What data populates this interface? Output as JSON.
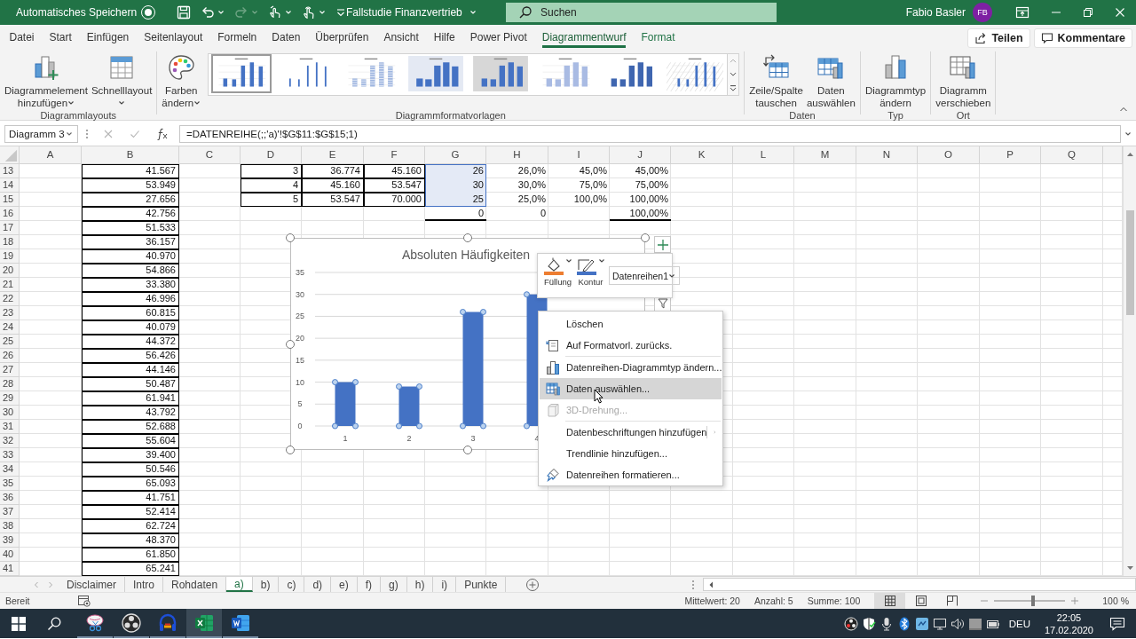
{
  "title_bar": {
    "autosave_label": "Automatisches Speichern",
    "autosave_on": false,
    "quick_access": [
      {
        "kind": "save",
        "disabled": false,
        "dropdown": false
      },
      {
        "kind": "undo",
        "disabled": false,
        "dropdown": true
      },
      {
        "kind": "redo",
        "disabled": true,
        "dropdown": true
      },
      {
        "kind": "touch",
        "disabled": false,
        "dropdown": true
      },
      {
        "kind": "pointer",
        "disabled": false,
        "dropdown": true
      },
      {
        "kind": "customize",
        "disabled": false,
        "dropdown": false
      }
    ],
    "document_title": "Fallstudie Finanzvertrieb",
    "search": {
      "placeholder": "Suchen"
    },
    "user_name": "Fabio Basler",
    "user_initials": "FB"
  },
  "ribbon_tabs": [
    {
      "label": "Datei",
      "kind": "normal",
      "selected": false
    },
    {
      "label": "Start",
      "kind": "normal",
      "selected": false
    },
    {
      "label": "Einfügen",
      "kind": "normal",
      "selected": false
    },
    {
      "label": "Seitenlayout",
      "kind": "normal",
      "selected": false
    },
    {
      "label": "Formeln",
      "kind": "normal",
      "selected": false
    },
    {
      "label": "Daten",
      "kind": "normal",
      "selected": false
    },
    {
      "label": "Überprüfen",
      "kind": "normal",
      "selected": false
    },
    {
      "label": "Ansicht",
      "kind": "normal",
      "selected": false
    },
    {
      "label": "Hilfe",
      "kind": "normal",
      "selected": false
    },
    {
      "label": "Power Pivot",
      "kind": "normal",
      "selected": false
    },
    {
      "label": "Diagrammentwurf",
      "kind": "contextual",
      "selected": true
    },
    {
      "label": "Format",
      "kind": "contextual",
      "selected": false
    }
  ],
  "share_button": "Teilen",
  "comments_button": "Kommentare",
  "ribbon_groups": [
    {
      "label": "Diagrammlayouts",
      "items": [
        {
          "kind": "add-element",
          "label": "Diagrammelement hinzufügen",
          "dropdown": true
        },
        {
          "kind": "quick-layout",
          "label": "Schnelllayout",
          "dropdown": true
        }
      ]
    },
    {
      "label": "Diagrammformatvorlagen",
      "items": [
        {
          "kind": "colors",
          "label": "Farben ändern",
          "dropdown": true
        },
        {
          "kind": "gallery",
          "styles": [
            {
              "selected": true
            },
            {
              "selected": false
            },
            {
              "selected": false
            },
            {
              "selected": false
            },
            {
              "selected": false
            },
            {
              "selected": false
            },
            {
              "selected": false
            },
            {
              "selected": false
            }
          ]
        }
      ]
    },
    {
      "label": "Daten",
      "items": [
        {
          "kind": "swap",
          "label": "Zeile/Spalte tauschen",
          "dropdown": false
        },
        {
          "kind": "select-data",
          "label": "Daten auswählen",
          "dropdown": false
        }
      ]
    },
    {
      "label": "Typ",
      "items": [
        {
          "kind": "change-type",
          "label": "Diagrammtyp ändern",
          "dropdown": false
        }
      ]
    },
    {
      "label": "Ort",
      "items": [
        {
          "kind": "move",
          "label": "Diagramm verschieben",
          "dropdown": false
        }
      ]
    }
  ],
  "formula_bar": {
    "name_box": "Diagramm 3",
    "formula": "=DATENREIHE(;;'a)'!$G$11:$G$15;1)"
  },
  "sheet": {
    "columns": [
      "A",
      "B",
      "C",
      "D",
      "E",
      "F",
      "G",
      "H",
      "I",
      "J",
      "K",
      "L",
      "M",
      "N",
      "O",
      "P",
      "Q"
    ],
    "rows": [
      {
        "header": "13",
        "cells": [
          {},
          {
            "value": "41.567",
            "highlighted": false
          },
          {},
          {
            "value": "3",
            "highlighted": false
          },
          {
            "value": "36.774",
            "highlighted": false
          },
          {
            "value": "45.160",
            "highlighted": false
          },
          {
            "value": "26",
            "highlighted": true
          },
          {
            "value": "26,0%",
            "highlighted": false
          },
          {
            "value": "45,0%",
            "highlighted": false
          },
          {
            "value": "45,00%",
            "highlighted": false
          }
        ]
      },
      {
        "header": "14",
        "cells": [
          {},
          {
            "value": "53.949",
            "highlighted": false
          },
          {},
          {
            "value": "4",
            "highlighted": false
          },
          {
            "value": "45.160",
            "highlighted": false
          },
          {
            "value": "53.547",
            "highlighted": false
          },
          {
            "value": "30",
            "highlighted": true
          },
          {
            "value": "30,0%",
            "highlighted": false
          },
          {
            "value": "75,0%",
            "highlighted": false
          },
          {
            "value": "75,00%",
            "highlighted": false
          }
        ]
      },
      {
        "header": "15",
        "cells": [
          {},
          {
            "value": "27.656",
            "highlighted": false
          },
          {},
          {
            "value": "5",
            "highlighted": false
          },
          {
            "value": "53.547",
            "highlighted": false
          },
          {
            "value": "70.000",
            "highlighted": false
          },
          {
            "value": "25",
            "highlighted": true
          },
          {
            "value": "25,0%",
            "highlighted": false
          },
          {
            "value": "100,0%",
            "highlighted": false
          },
          {
            "value": "100,00%",
            "highlighted": false
          }
        ]
      },
      {
        "header": "16",
        "cells": [
          {},
          {
            "value": "42.756",
            "highlighted": false
          },
          {},
          {},
          {},
          {},
          {
            "value": "0",
            "highlighted": false
          },
          {
            "value": "0",
            "highlighted": false
          },
          {},
          {
            "value": "100,00%",
            "highlighted": false
          }
        ]
      },
      {
        "header": "17",
        "cells": [
          {},
          {
            "value": "51.533",
            "highlighted": false
          }
        ]
      },
      {
        "header": "18",
        "cells": [
          {},
          {
            "value": "36.157",
            "highlighted": false
          }
        ]
      },
      {
        "header": "19",
        "cells": [
          {},
          {
            "value": "40.970",
            "highlighted": false
          }
        ]
      },
      {
        "header": "20",
        "cells": [
          {},
          {
            "value": "54.866",
            "highlighted": false
          }
        ]
      },
      {
        "header": "21",
        "cells": [
          {},
          {
            "value": "33.380",
            "highlighted": false
          }
        ]
      },
      {
        "header": "22",
        "cells": [
          {},
          {
            "value": "46.996",
            "highlighted": false
          }
        ]
      },
      {
        "header": "23",
        "cells": [
          {},
          {
            "value": "60.815",
            "highlighted": false
          }
        ]
      },
      {
        "header": "24",
        "cells": [
          {},
          {
            "value": "40.079",
            "highlighted": false
          }
        ]
      },
      {
        "header": "25",
        "cells": [
          {},
          {
            "value": "44.372",
            "highlighted": false
          }
        ]
      },
      {
        "header": "26",
        "cells": [
          {},
          {
            "value": "56.426",
            "highlighted": false
          }
        ]
      },
      {
        "header": "27",
        "cells": [
          {},
          {
            "value": "44.146",
            "highlighted": false
          }
        ]
      },
      {
        "header": "28",
        "cells": [
          {},
          {
            "value": "50.487",
            "highlighted": false
          }
        ]
      },
      {
        "header": "29",
        "cells": [
          {},
          {
            "value": "61.941",
            "highlighted": false
          }
        ]
      },
      {
        "header": "30",
        "cells": [
          {},
          {
            "value": "43.792",
            "highlighted": false
          }
        ]
      },
      {
        "header": "31",
        "cells": [
          {},
          {
            "value": "52.688",
            "highlighted": false
          }
        ]
      },
      {
        "header": "32",
        "cells": [
          {},
          {
            "value": "55.604",
            "highlighted": false
          }
        ]
      },
      {
        "header": "33",
        "cells": [
          {},
          {
            "value": "39.400",
            "highlighted": false
          }
        ]
      },
      {
        "header": "34",
        "cells": [
          {},
          {
            "value": "50.546",
            "highlighted": false
          }
        ]
      },
      {
        "header": "35",
        "cells": [
          {},
          {
            "value": "65.093",
            "highlighted": false
          }
        ]
      },
      {
        "header": "36",
        "cells": [
          {},
          {
            "value": "41.751",
            "highlighted": false
          }
        ]
      },
      {
        "header": "37",
        "cells": [
          {},
          {
            "value": "52.414",
            "highlighted": false
          }
        ]
      },
      {
        "header": "38",
        "cells": [
          {},
          {
            "value": "62.724",
            "highlighted": false
          }
        ]
      },
      {
        "header": "39",
        "cells": [
          {},
          {
            "value": "48.370",
            "highlighted": false
          }
        ]
      },
      {
        "header": "40",
        "cells": [
          {},
          {
            "value": "61.850",
            "highlighted": false
          }
        ]
      },
      {
        "header": "41",
        "cells": [
          {},
          {
            "value": "65.241",
            "highlighted": false
          }
        ]
      }
    ]
  },
  "chart": {
    "selected": true,
    "chart_data": {
      "type": "bar",
      "title": "Absoluten Häufigkeiten",
      "categories": [
        "1",
        "2",
        "3",
        "4"
      ],
      "series": [
        {
          "color": "#4472c4",
          "values": [
            10,
            9,
            26,
            30
          ]
        }
      ],
      "ylim": [
        0,
        35
      ],
      "yticks": [
        0,
        5,
        10,
        15,
        20,
        25,
        30,
        35
      ],
      "grid": true
    }
  },
  "mini_toolbar": {
    "fill_label": "Füllung",
    "outline_label": "Kontur",
    "series_dropdown": "Datenreihen1"
  },
  "context_menu": [
    {
      "kind": "item",
      "label": "Löschen",
      "disabled": false,
      "selected": false
    },
    {
      "kind": "item",
      "label": "Auf Formatvorl. zurücks.",
      "disabled": false,
      "selected": false
    },
    {
      "kind": "separator"
    },
    {
      "kind": "item",
      "label": "Datenreihen-Diagrammtyp ändern...",
      "disabled": false,
      "selected": false
    },
    {
      "kind": "item",
      "label": "Daten auswählen...",
      "disabled": false,
      "selected": true
    },
    {
      "kind": "item",
      "label": "3D-Drehung...",
      "disabled": true,
      "selected": false
    },
    {
      "kind": "separator"
    },
    {
      "kind": "submenu",
      "label": "Datenbeschriftungen hinzufügen",
      "disabled": false,
      "selected": false
    },
    {
      "kind": "item",
      "label": "Trendlinie hinzufügen...",
      "disabled": false,
      "selected": false
    },
    {
      "kind": "item",
      "label": "Datenreihen formatieren...",
      "disabled": false,
      "selected": false
    }
  ],
  "sheet_tabs": [
    {
      "label": "Disclaimer",
      "selected": false
    },
    {
      "label": "Intro",
      "selected": false
    },
    {
      "label": "Rohdaten",
      "selected": false
    },
    {
      "label": "a)",
      "selected": true
    },
    {
      "label": "b)",
      "selected": false
    },
    {
      "label": "c)",
      "selected": false
    },
    {
      "label": "d)",
      "selected": false
    },
    {
      "label": "e)",
      "selected": false
    },
    {
      "label": "f)",
      "selected": false
    },
    {
      "label": "g)",
      "selected": false
    },
    {
      "label": "h)",
      "selected": false
    },
    {
      "label": "i)",
      "selected": false
    },
    {
      "label": "Punkte",
      "selected": false
    }
  ],
  "status_bar": {
    "status": "Bereit",
    "average": "Mittelwert: 20",
    "count": "Anzahl: 5",
    "sum": "Summe: 100",
    "views": [
      {
        "kind": "normal",
        "selected": true
      },
      {
        "kind": "page-layout",
        "selected": false
      },
      {
        "kind": "page-break",
        "selected": false
      }
    ],
    "zoom": {
      "level": 0.52,
      "reading": "100 %"
    }
  },
  "taskbar": {
    "apps": [
      {
        "kind": "snip",
        "selected": false
      },
      {
        "kind": "obs",
        "selected": false
      },
      {
        "kind": "audio",
        "selected": false
      },
      {
        "kind": "excel",
        "selected": true
      },
      {
        "kind": "word",
        "selected": false
      }
    ],
    "tray": [
      {
        "kind": "obs"
      },
      {
        "kind": "shield"
      },
      {
        "kind": "mic"
      },
      {
        "kind": "bluetooth"
      },
      {
        "kind": "app"
      },
      {
        "kind": "display"
      },
      {
        "kind": "volume"
      },
      {
        "kind": "drive"
      },
      {
        "kind": "battery"
      }
    ],
    "language": "DEU",
    "time": "22:05",
    "date": "17.02.2020"
  }
}
